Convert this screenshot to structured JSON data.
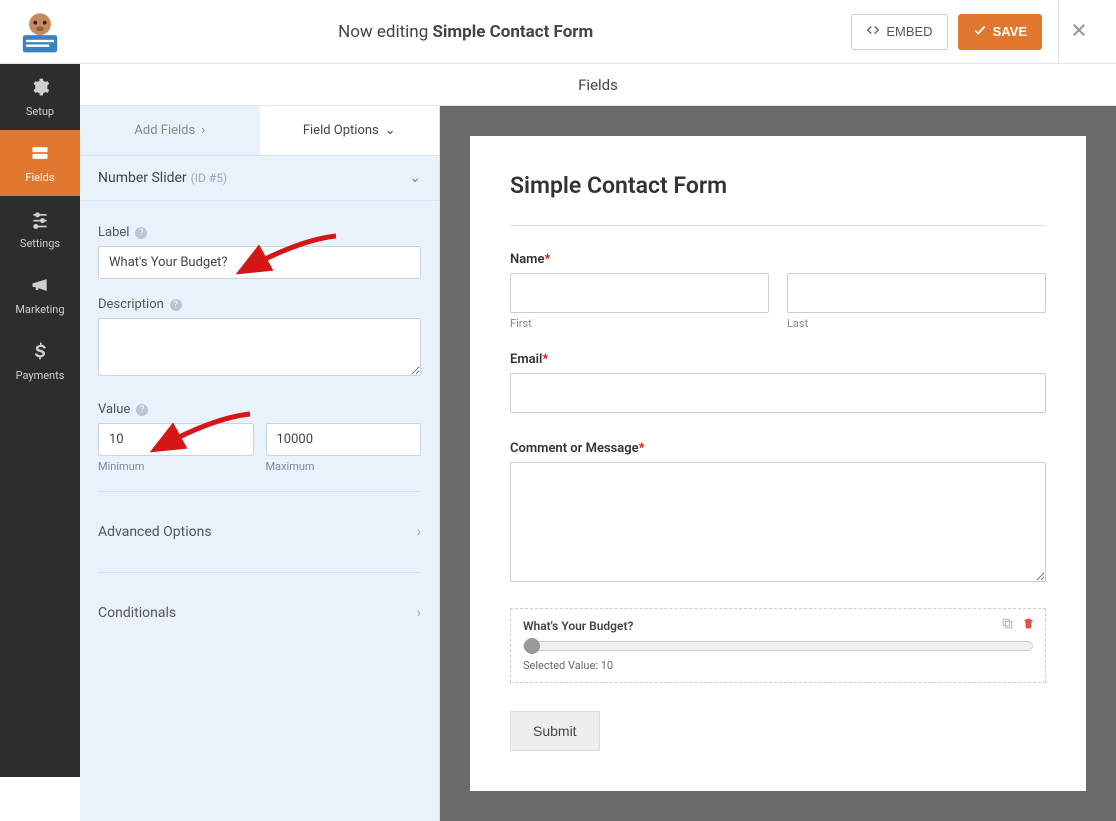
{
  "topbar": {
    "editing_prefix": "Now editing ",
    "form_name": "Simple Contact Form",
    "embed_label": "EMBED",
    "save_label": "SAVE"
  },
  "sidenav": {
    "setup": "Setup",
    "fields": "Fields",
    "settings": "Settings",
    "marketing": "Marketing",
    "payments": "Payments"
  },
  "header": {
    "title": "Fields"
  },
  "tabs": {
    "add_fields": "Add Fields",
    "field_options": "Field Options"
  },
  "field_title": {
    "name": "Number Slider",
    "id": "(ID #5)"
  },
  "options": {
    "label_label": "Label",
    "label_value": "What's Your Budget?",
    "description_label": "Description",
    "description_value": "",
    "value_label": "Value",
    "min_value": "10",
    "max_value": "10000",
    "min_sub": "Minimum",
    "max_sub": "Maximum",
    "adv_label": "Advanced Options",
    "cond_label": "Conditionals"
  },
  "preview": {
    "form_title": "Simple Contact Form",
    "name_label": "Name",
    "first_sub": "First",
    "last_sub": "Last",
    "email_label": "Email",
    "comment_label": "Comment or Message",
    "slider_label": "What's Your Budget?",
    "slider_value_text": "Selected Value: 10",
    "submit_label": "Submit"
  }
}
